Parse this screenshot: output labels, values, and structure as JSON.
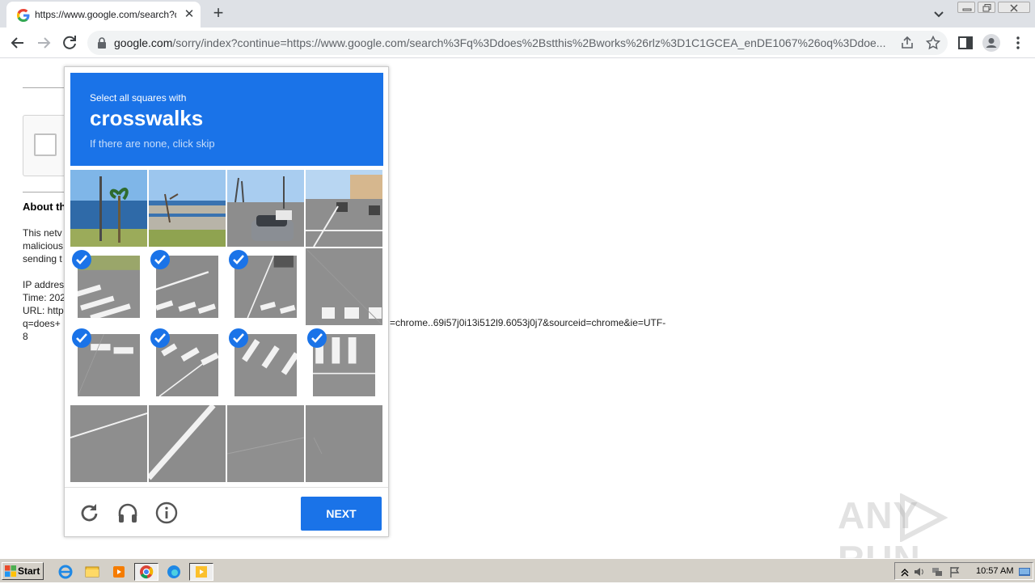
{
  "browser": {
    "tab_title": "https://www.google.com/search?q=",
    "tab_close": "✕",
    "new_tab": "+",
    "url_host": "google.com",
    "url_rest": "/sorry/index?continue=https://www.google.com/search%3Fq%3Ddoes%2Bstthis%2Bworks%26rlz%3D1C1GCEA_enDE1067%26oq%3Ddoe..."
  },
  "page": {
    "about_heading": "About th",
    "para": [
      "This netv",
      "malicious",
      "sending t"
    ],
    "ip_lines": [
      "IP addres",
      "Time: 202",
      "URL: http",
      "q=does+",
      "8"
    ],
    "url_tail": "=chrome..69i57j0i13i512l9.6053j0j7&sourceid=chrome&ie=UTF-"
  },
  "captcha": {
    "instruction_small": "Select all squares with",
    "target_word": "crosswalks",
    "hint": "If there are none, click skip",
    "next_label": "NEXT",
    "tiles": [
      {
        "selected": false
      },
      {
        "selected": false
      },
      {
        "selected": false
      },
      {
        "selected": false
      },
      {
        "selected": true
      },
      {
        "selected": true
      },
      {
        "selected": true
      },
      {
        "selected": false
      },
      {
        "selected": true
      },
      {
        "selected": true
      },
      {
        "selected": true
      },
      {
        "selected": true
      },
      {
        "selected": false
      },
      {
        "selected": false
      },
      {
        "selected": false
      },
      {
        "selected": false
      }
    ],
    "accent_color": "#1a73e8"
  },
  "watermark": {
    "left": "ANY",
    "right": "RUN"
  },
  "taskbar": {
    "start_label": "Start",
    "clock": "10:57 AM"
  }
}
